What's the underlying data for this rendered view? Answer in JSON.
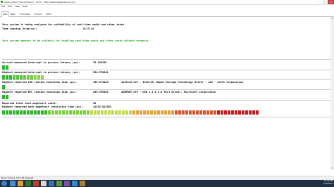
{
  "window": {
    "title": "LatencyMon (Home Edition) - v3.50 - http://www.resplendence.com",
    "minimize": "–",
    "maximize": "□",
    "close": "×"
  },
  "menu": [
    "File",
    "Edit",
    "View",
    "Help"
  ],
  "tabs": [
    "Main",
    "Stats",
    "Processes",
    "Drivers",
    "CPUs"
  ],
  "main": {
    "analysis_line": "Your system is being analysed for suitability of real-time audio and other tasks.",
    "time_label": "Time running (h:mm:ss):",
    "time_value": "0:17:24",
    "verdict": "Your system appears to be suitable for handling real-time audio and other tasks without dropouts.",
    "metrics": [
      {
        "label": "Current measured interrupt to process latency (µs):",
        "value": "70.420128",
        "detail": "",
        "bar": {
          "level": 0.03,
          "colors": [
            "#2fb52f"
          ]
        }
      },
      {
        "label": "Highest measured interrupt to process latency (µs):",
        "value": "254.578241",
        "detail": "",
        "bar": {
          "level": 0.17,
          "colors": [
            "#2fb52f",
            "#52c23a",
            "#6fcb3e",
            "#8fd448"
          ]
        }
      },
      {
        "label": "Highest reported ISR routine execution time (µs):",
        "value": "199.573429",
        "detail": "iaStorA.SYS - Intel(R) Rapid Storage Technology driver - x64 - Intel Corporation",
        "bar": {
          "level": 0.02,
          "colors": [
            "#2fb52f"
          ]
        }
      },
      {
        "label": "Highest reported DPC routine execution time (µs):",
        "value": "299.559365",
        "detail": "USBPORT.SYS - USB 1.1 & 2.0 Port Driver, Microsoft Corporation",
        "bar": {
          "level": 0.03,
          "colors": [
            "#2fb52f"
          ]
        }
      },
      {
        "label": "Reported total hard pagefault count:",
        "value": "36",
        "detail": "",
        "bar": null
      },
      {
        "label": "Highest reported hard pagefault resolution time (µs):",
        "value": "31325.021583",
        "detail": "",
        "bar": {
          "level": 1.0,
          "colors": [
            "#2fb52f",
            "#7ccf3f",
            "#c7d84a",
            "#e0a53b",
            "#d8562f",
            "#c22020"
          ]
        }
      }
    ]
  },
  "status_bar": "Now running. 0:17:24 elapsed.",
  "tray": {
    "time": "12:04 PM",
    "date": "7/16/2012"
  },
  "colors": {
    "verdict_green": "#1f9a1f",
    "bar_green": "#2fb52f",
    "bar_red": "#c22020",
    "taskbar": "#1f2f44"
  }
}
